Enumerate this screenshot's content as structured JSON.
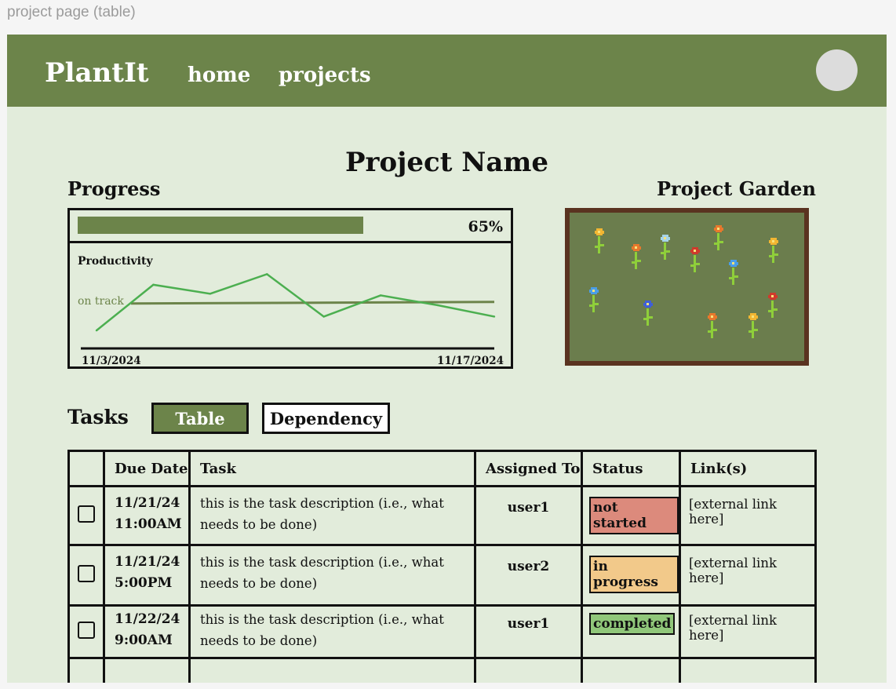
{
  "frame_label": "project page (table)",
  "nav": {
    "brand": "PlantIt",
    "links": [
      "home",
      "projects"
    ]
  },
  "page": {
    "title": "Project Name",
    "progress_heading": "Progress",
    "garden_heading": "Project Garden"
  },
  "progress": {
    "value": 0.65,
    "label": "65%"
  },
  "chart_data": {
    "type": "line",
    "title": "Productivity",
    "x_start_label": "11/3/2024",
    "x_end_label": "11/17/2024",
    "ylim": [
      0,
      100
    ],
    "series": [
      {
        "name": "",
        "color": "#4caf50",
        "values": [
          22,
          78,
          67,
          91,
          39,
          65,
          53,
          39
        ]
      }
    ],
    "reference_line": {
      "label": "on track",
      "value": 56,
      "color": "#6c844a"
    }
  },
  "tasks": {
    "heading": "Tasks",
    "view_tabs": [
      "Table",
      "Dependency"
    ],
    "active_view": "Table",
    "columns": [
      "",
      "Due Date",
      "Task",
      "Assigned To",
      "Status",
      "Link(s)"
    ],
    "rows": [
      {
        "date": "11/21/24",
        "time": "11:00AM",
        "task": "this is the task description (i.e., what needs to be done)",
        "assignee": "user1",
        "status": "not started",
        "status_color": "#dc8a7c",
        "link": "[external link here]"
      },
      {
        "date": "11/21/24",
        "time": "5:00PM",
        "task": "this is the task description (i.e., what needs to be done)",
        "assignee": "user2",
        "status": "in progress",
        "status_color": "#f2c98a",
        "link": "[external link here]"
      },
      {
        "date": "11/22/24",
        "time": "9:00AM",
        "task": "this is the task description (i.e., what needs to be done)",
        "assignee": "user1",
        "status": "completed",
        "status_color": "#90c77a",
        "link": "[external link here]"
      }
    ]
  },
  "colors": {
    "nav_bg": "#6c844a",
    "page_bg": "#e2ecdb",
    "garden_bg": "#6b7d4d",
    "garden_border": "#5a3320"
  },
  "garden_flowers": [
    {
      "petal": "#f2b632"
    },
    {
      "petal": "#e8782c"
    },
    {
      "petal": "#a6d4e8"
    },
    {
      "petal": "#cf3a2c"
    },
    {
      "petal": "#e8782c"
    },
    {
      "petal": "#f2b632"
    },
    {
      "petal": "#4a9ee8"
    },
    {
      "petal": "#4a9ee8"
    },
    {
      "petal": "#3f5fd8"
    },
    {
      "petal": "#e8782c"
    },
    {
      "petal": "#f2b632"
    },
    {
      "petal": "#cf3a2c"
    }
  ]
}
